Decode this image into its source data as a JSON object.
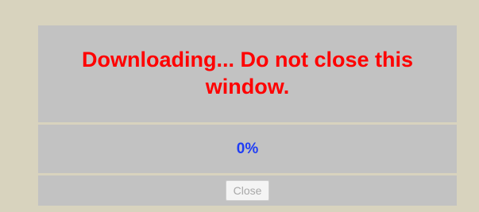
{
  "dialog": {
    "message": "Downloading... Do not close this window.",
    "progress_text": "0%",
    "progress_value": 0,
    "close_label": "Close",
    "close_enabled": false
  },
  "colors": {
    "background": "#d8d3be",
    "panel": "#c2c2c2",
    "message": "#ff0000",
    "progress_text": "#1f3df5",
    "button_text_disabled": "#a8a8a8"
  }
}
